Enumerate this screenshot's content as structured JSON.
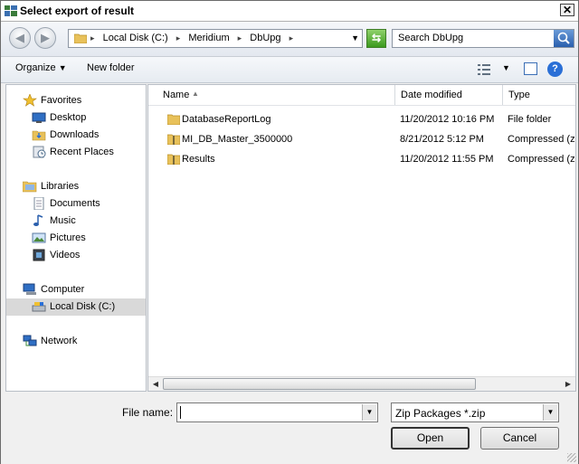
{
  "window": {
    "title": "Select export of result"
  },
  "address": {
    "crumbs": [
      "Local Disk (C:)",
      "Meridium",
      "DbUpg"
    ]
  },
  "search": {
    "placeholder": "Search DbUpg"
  },
  "toolbar": {
    "organize": "Organize",
    "new_folder": "New folder"
  },
  "nav": {
    "favorites": "Favorites",
    "desktop": "Desktop",
    "downloads": "Downloads",
    "recent": "Recent Places",
    "libraries": "Libraries",
    "documents": "Documents",
    "music": "Music",
    "pictures": "Pictures",
    "videos": "Videos",
    "computer": "Computer",
    "local_disk": "Local Disk (C:)",
    "network": "Network"
  },
  "columns": {
    "name": "Name",
    "date": "Date modified",
    "type": "Type"
  },
  "files": [
    {
      "name": "DatabaseReportLog",
      "date": "11/20/2012 10:16 PM",
      "type": "File folder",
      "icon": "folder-icon"
    },
    {
      "name": "MI_DB_Master_3500000",
      "date": "8/21/2012 5:12 PM",
      "type": "Compressed (zip",
      "icon": "zip-folder-icon"
    },
    {
      "name": "Results",
      "date": "11/20/2012 11:55 PM",
      "type": "Compressed (zip",
      "icon": "zip-folder-icon"
    }
  ],
  "bottom": {
    "file_name_label": "File name:",
    "file_name_value": "",
    "file_type": "Zip Packages *.zip",
    "open": "Open",
    "cancel": "Cancel"
  },
  "colors": {
    "folder": "#e8c15a",
    "selection": "#d9d9d9",
    "accent": "#2a6fd6"
  }
}
